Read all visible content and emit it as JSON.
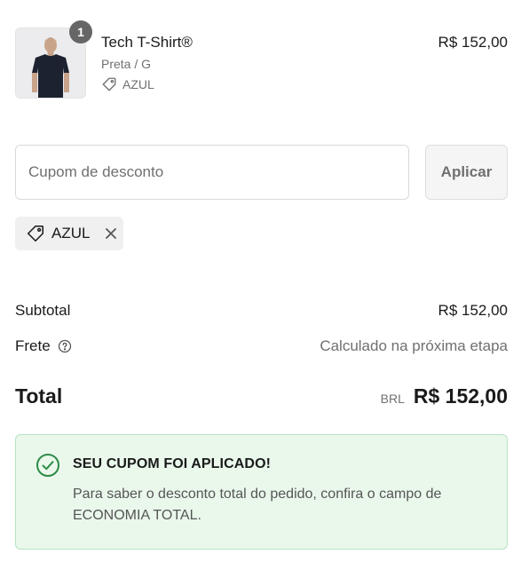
{
  "product": {
    "quantity": "1",
    "name": "Tech T-Shirt®",
    "variant": "Preta / G",
    "discount_code": "AZUL",
    "price": "R$ 152,00",
    "image_icon": "t-shirt-photo"
  },
  "coupon": {
    "placeholder": "Cupom de desconto",
    "value": "",
    "apply_label": "Aplicar",
    "applied_tag": "AZUL"
  },
  "summary": {
    "subtotal_label": "Subtotal",
    "subtotal_value": "R$ 152,00",
    "shipping_label": "Frete",
    "shipping_value": "Calculado na próxima etapa",
    "total_label": "Total",
    "currency": "BRL",
    "total_value": "R$ 152,00"
  },
  "banner": {
    "title": "SEU CUPOM FOI APLICADO!",
    "message": "Para saber o desconto total do pedido, confira o campo de ECONOMIA TOTAL.",
    "accent_color": "#2e8b46",
    "background_color": "#eaf8ec"
  }
}
